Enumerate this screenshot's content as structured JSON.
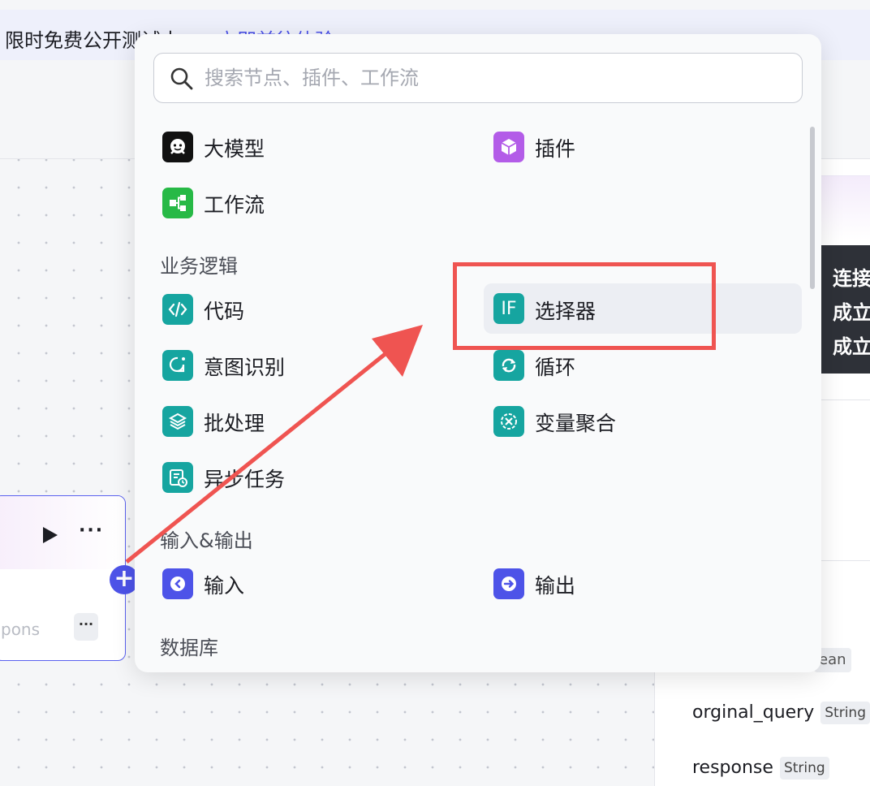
{
  "banner": {
    "text": "限时免费公开测试中",
    "link": "立即前往体验"
  },
  "node": {
    "output_label": "pons",
    "more_label": "···",
    "menu_label": "···"
  },
  "plus_label": "+",
  "right_panel": {
    "type_fragment": "ean",
    "vars": [
      {
        "name": "orginal_query",
        "type": "String"
      },
      {
        "name": "response",
        "type": "String"
      }
    ]
  },
  "tooltip": {
    "lines": [
      "连接",
      "成立",
      "成立"
    ]
  },
  "popup": {
    "search_placeholder": "搜索节点、插件、工作流",
    "top_items": [
      {
        "label": "大模型",
        "icon": "llm-face-icon",
        "color": "#111111"
      },
      {
        "label": "插件",
        "icon": "plugin-cube-icon",
        "color": "#b35ce8"
      },
      {
        "label": "工作流",
        "icon": "workflow-icon",
        "color": "#27b946"
      }
    ],
    "sections": [
      {
        "title": "业务逻辑",
        "items": [
          {
            "label": "代码",
            "icon": "code-icon",
            "color": "#16a5a0"
          },
          {
            "label": "选择器",
            "icon": "if-selector-icon",
            "color": "#16a5a0"
          },
          {
            "label": "意图识别",
            "icon": "intent-icon",
            "color": "#16a5a0"
          },
          {
            "label": "循环",
            "icon": "loop-icon",
            "color": "#16a5a0"
          },
          {
            "label": "批处理",
            "icon": "batch-icon",
            "color": "#16a5a0"
          },
          {
            "label": "变量聚合",
            "icon": "variable-merge-icon",
            "color": "#16a5a0"
          },
          {
            "label": "异步任务",
            "icon": "async-task-icon",
            "color": "#16a5a0"
          }
        ]
      },
      {
        "title": "输入&输出",
        "items": [
          {
            "label": "输入",
            "icon": "input-icon",
            "color": "#4d53e8"
          },
          {
            "label": "输出",
            "icon": "output-icon",
            "color": "#4d53e8"
          }
        ]
      },
      {
        "title": "数据库",
        "items": []
      }
    ],
    "if_icon_text": "IF"
  },
  "colors": {
    "accent": "#4d53e8",
    "teal": "#16a5a0",
    "annotation_red": "#ef5451"
  }
}
